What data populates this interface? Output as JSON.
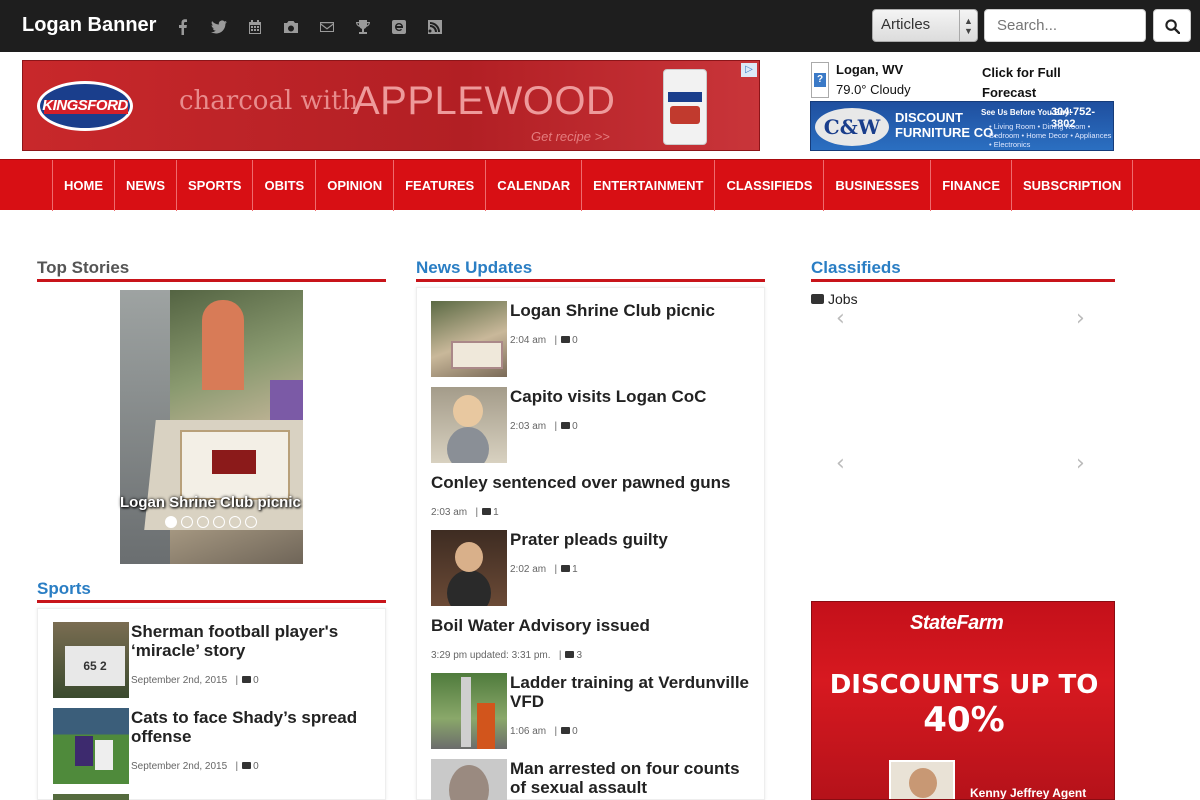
{
  "header": {
    "brand": "Logan Banner",
    "social_icons": [
      "facebook-icon",
      "twitter-icon",
      "calendar-icon",
      "camera-icon",
      "mail-icon",
      "trophy-icon",
      "e-edition-icon",
      "rss-icon"
    ],
    "search_scope": "Articles",
    "search_placeholder": "Search..."
  },
  "ads": {
    "kingsford": {
      "brand": "KINGSFORD",
      "line1": "charcoal with",
      "line2": "APPLEWOOD",
      "cta": "Get recipe >>"
    },
    "cw": {
      "logo": "C&W",
      "name_line1": "DISCOUNT",
      "name_line2": "FURNITURE CO.",
      "tagline": "See Us Before You Buy!",
      "phone": "304-752-3802",
      "items": "• Living Room • Dining Room • Bedroom • Home Decor • Appliances • Electronics"
    },
    "statefarm": {
      "brand": "StateFarm",
      "headline1": "DISCOUNTS UP TO",
      "headline2": "40%",
      "agent": "Kenny Jeffrey Agent"
    }
  },
  "weather": {
    "city": "Logan, WV",
    "conditions": "79.0° Cloudy",
    "link_line1": "Click for Full",
    "link_line2": "Forecast"
  },
  "nav": [
    "HOME",
    "NEWS",
    "SPORTS",
    "OBITS",
    "OPINION",
    "FEATURES",
    "CALENDAR",
    "ENTERTAINMENT",
    "CLASSIFIEDS",
    "BUSINESSES",
    "FINANCE",
    "SUBSCRIPTION"
  ],
  "top_stories": {
    "heading": "Top Stories",
    "caption": "Logan Shrine Club picnic",
    "slide_count": 6,
    "active_slide": 1
  },
  "sports": {
    "heading": "Sports",
    "items": [
      {
        "title_line1": "Sherman football player's",
        "title_line2": "‘miracle’ story",
        "date": "September 2nd, 2015",
        "comments": "0"
      },
      {
        "title_line1": "Cats to face Shady’s spread",
        "title_line2": "offense",
        "date": "September 2nd, 2015",
        "comments": "0"
      }
    ]
  },
  "news_updates": {
    "heading": "News Updates",
    "items": [
      {
        "title": "Logan Shrine Club picnic",
        "time": "2:04 am",
        "comments": "0"
      },
      {
        "title": "Capito visits Logan CoC",
        "time": "2:03 am",
        "comments": "0"
      },
      {
        "title": "Conley sentenced over pawned guns",
        "time": "2:03 am",
        "comments": "1"
      },
      {
        "title": "Prater pleads guilty",
        "time": "2:02 am",
        "comments": "1"
      },
      {
        "title": "Boil Water Advisory issued",
        "time": "3:29 pm updated: 3:31 pm.",
        "comments": "3"
      },
      {
        "title_line1": "Ladder training at Verdunville",
        "title_line2": "VFD",
        "time": "1:06 am",
        "comments": "0"
      },
      {
        "title_line1": "Man arrested on four counts",
        "title_line2": "of sexual assault"
      }
    ]
  },
  "classifieds": {
    "heading": "Classifieds",
    "category": "Jobs"
  },
  "colors": {
    "nav_red": "#d80f14",
    "heading_blue": "#2a7ec4",
    "topbar": "#1e1e1e"
  }
}
